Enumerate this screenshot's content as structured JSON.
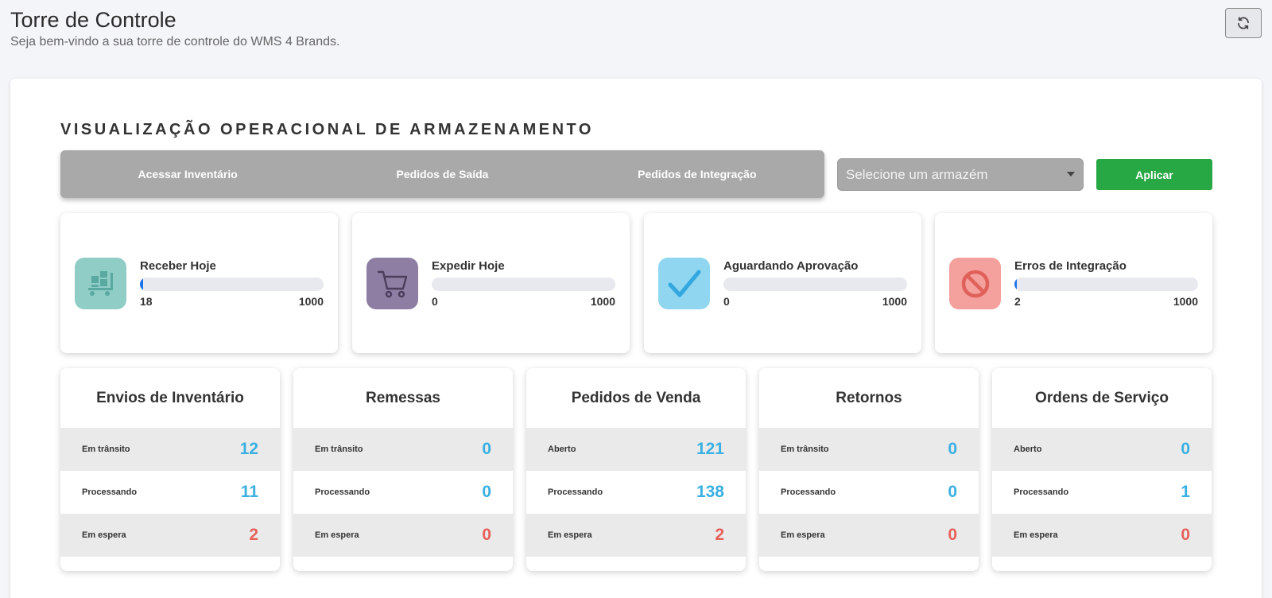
{
  "header": {
    "title": "Torre de Controle",
    "subtitle": "Seja bem-vindo a sua torre de controle do WMS 4 Brands."
  },
  "section": {
    "title": "VISUALIZAÇÃO OPERACIONAL DE ARMAZENAMENTO"
  },
  "nav": {
    "items": [
      {
        "label": "Acessar Inventário"
      },
      {
        "label": "Pedidos de Saída"
      },
      {
        "label": "Pedidos de Integração"
      }
    ]
  },
  "filter": {
    "warehouse_placeholder": "Selecione um armazém",
    "apply_label": "Aplicar"
  },
  "stats": [
    {
      "label": "Receber Hoje",
      "value": "18",
      "max": "1000",
      "progress": 0.018,
      "icon": "warehouse-cart-icon",
      "color": "#8fcdc6"
    },
    {
      "label": "Expedir Hoje",
      "value": "0",
      "max": "1000",
      "progress": 0,
      "icon": "shopping-cart-icon",
      "color": "#8f7ea3"
    },
    {
      "label": "Aguardando Aprovação",
      "value": "0",
      "max": "1000",
      "progress": 0,
      "icon": "checkmark-icon",
      "color": "#90d6f0"
    },
    {
      "label": "Erros de Integração",
      "value": "2",
      "max": "1000",
      "progress": 0.002,
      "icon": "prohibited-icon",
      "color": "#f4a09c"
    }
  ],
  "summaries": [
    {
      "title": "Envios de Inventário",
      "rows": [
        {
          "label": "Em trânsito",
          "value": "12",
          "color": "blue"
        },
        {
          "label": "Processando",
          "value": "11",
          "color": "blue"
        },
        {
          "label": "Em espera",
          "value": "2",
          "color": "red"
        }
      ]
    },
    {
      "title": "Remessas",
      "rows": [
        {
          "label": "Em trânsito",
          "value": "0",
          "color": "blue"
        },
        {
          "label": "Processando",
          "value": "0",
          "color": "blue"
        },
        {
          "label": "Em espera",
          "value": "0",
          "color": "red"
        }
      ]
    },
    {
      "title": "Pedidos de Venda",
      "rows": [
        {
          "label": "Aberto",
          "value": "121",
          "color": "blue"
        },
        {
          "label": "Processando",
          "value": "138",
          "color": "blue"
        },
        {
          "label": "Em espera",
          "value": "2",
          "color": "red"
        }
      ]
    },
    {
      "title": "Retornos",
      "rows": [
        {
          "label": "Em trânsito",
          "value": "0",
          "color": "blue"
        },
        {
          "label": "Processando",
          "value": "0",
          "color": "blue"
        },
        {
          "label": "Em espera",
          "value": "0",
          "color": "red"
        }
      ]
    },
    {
      "title": "Ordens de Serviço",
      "rows": [
        {
          "label": "Aberto",
          "value": "0",
          "color": "blue"
        },
        {
          "label": "Processando",
          "value": "1",
          "color": "blue"
        },
        {
          "label": "Em espera",
          "value": "0",
          "color": "red"
        }
      ]
    }
  ],
  "colors": {
    "accent_blue": "#3ab0e2",
    "accent_red": "#e8605a",
    "apply_green": "#28a745"
  }
}
